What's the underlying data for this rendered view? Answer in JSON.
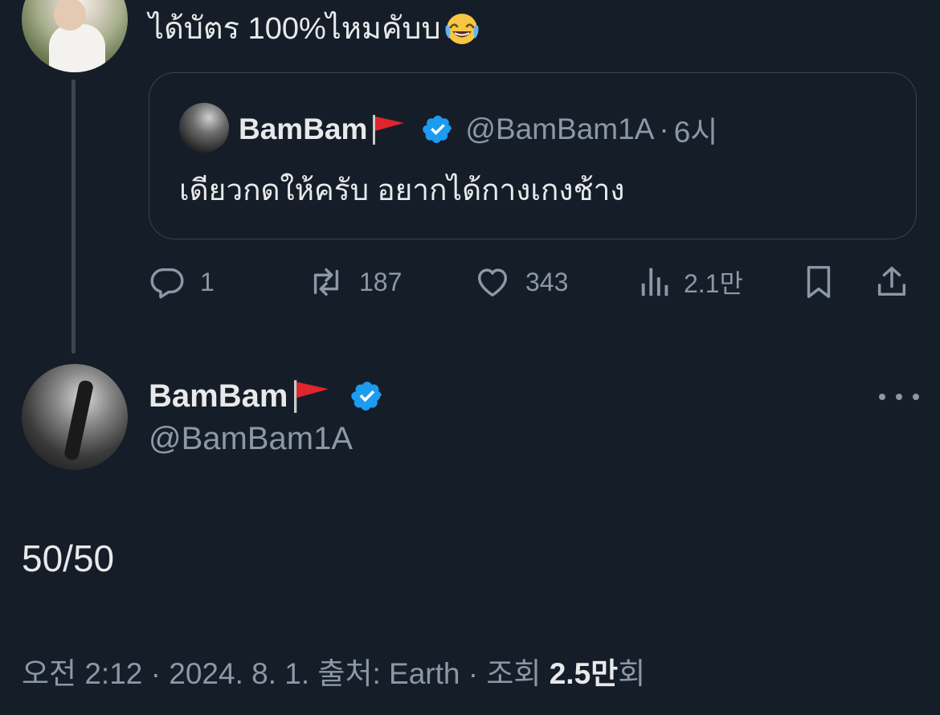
{
  "top_reply": {
    "text": "ได้บัตร 100%ไหมคับบ",
    "emoji": "face-with-tears-of-joy-icon"
  },
  "quoted_tweet": {
    "display_name": "BamBam",
    "handle": "@BamBam1A",
    "separator": "·",
    "time": "6시",
    "text": "เดียวกดให้ครับ อยากได้กางเกงช้าง"
  },
  "actions": {
    "replies": "1",
    "retweets": "187",
    "likes": "343",
    "views": "2.1만"
  },
  "main_tweet": {
    "display_name": "BamBam",
    "handle": "@BamBam1A",
    "text": "50/50",
    "meta": {
      "time_date_prefix": "오전 2:12 · 2024. 8. 1. 출처: Earth · 조회 ",
      "views": "2.5만",
      "views_suffix": "회"
    }
  },
  "colors": {
    "background": "#151d28",
    "text_primary": "#e7e9ea",
    "text_secondary": "#8b98a5",
    "verified_blue": "#1d9bf0",
    "flag_red": "#e0252d"
  }
}
